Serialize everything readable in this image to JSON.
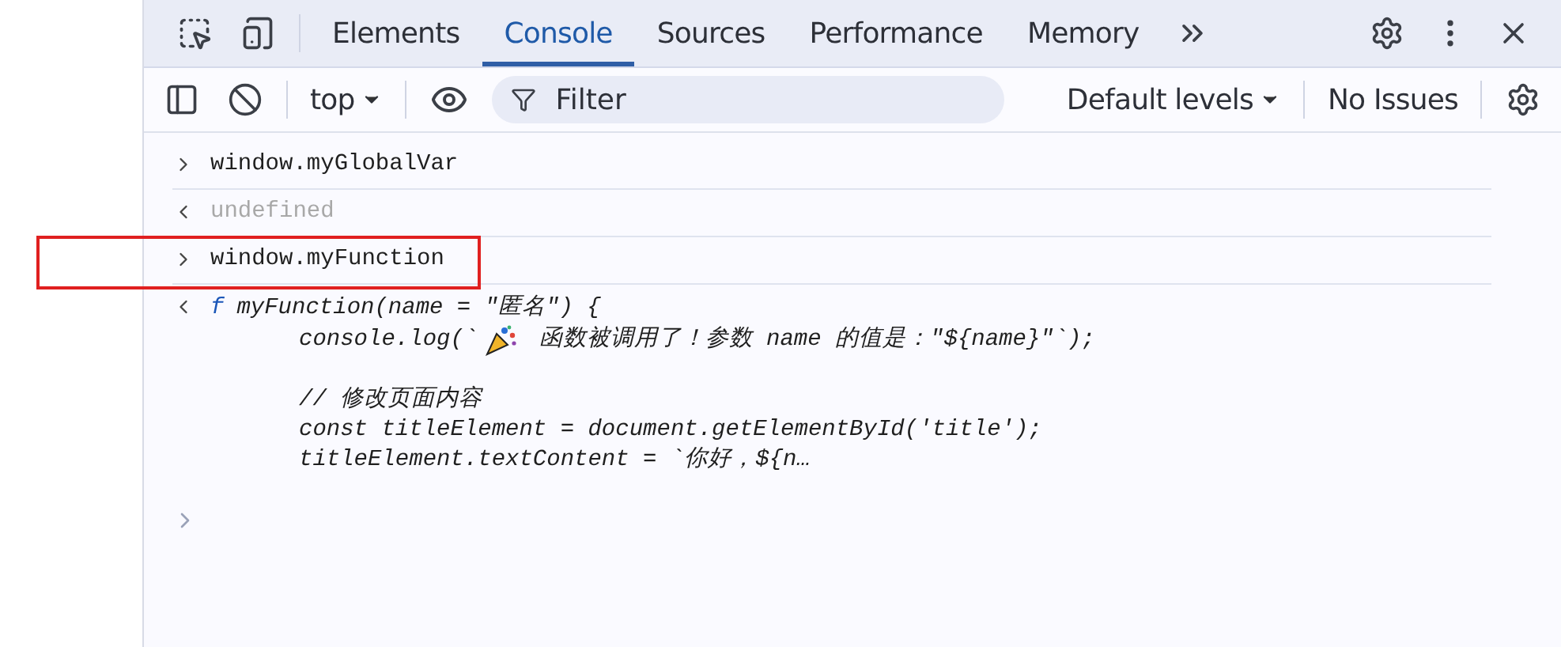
{
  "tabs": [
    {
      "label": "Elements",
      "selected": false
    },
    {
      "label": "Console",
      "selected": true
    },
    {
      "label": "Sources",
      "selected": false
    },
    {
      "label": "Performance",
      "selected": false
    },
    {
      "label": "Memory",
      "selected": false
    }
  ],
  "toolbar": {
    "context": "top",
    "filter": {
      "placeholder": "Filter"
    },
    "levels": "Default levels",
    "issues": "No Issues"
  },
  "entries": [
    {
      "kind": "input",
      "text": "window.myGlobalVar",
      "highlighted": false
    },
    {
      "kind": "output",
      "text": "undefined",
      "highlighted": false
    },
    {
      "kind": "input",
      "text": "window.myFunction",
      "highlighted": true
    },
    {
      "kind": "function",
      "prefix": "f",
      "lines": [
        {
          "kind": "code",
          "text": "myFunction(name = \"匿名\") {"
        },
        {
          "kind": "icon",
          "before": "console.log(`",
          "after": " 函数被调用了！参数 name 的值是：\"${name}\"`);"
        },
        {
          "kind": "blank"
        },
        {
          "kind": "code",
          "text": "// 修改页面内容"
        },
        {
          "kind": "code",
          "text": "const titleElement = document.getElementById('title');"
        },
        {
          "kind": "code",
          "text": "titleElement.textContent = `你好，${n…"
        }
      ],
      "highlighted": false
    }
  ]
}
